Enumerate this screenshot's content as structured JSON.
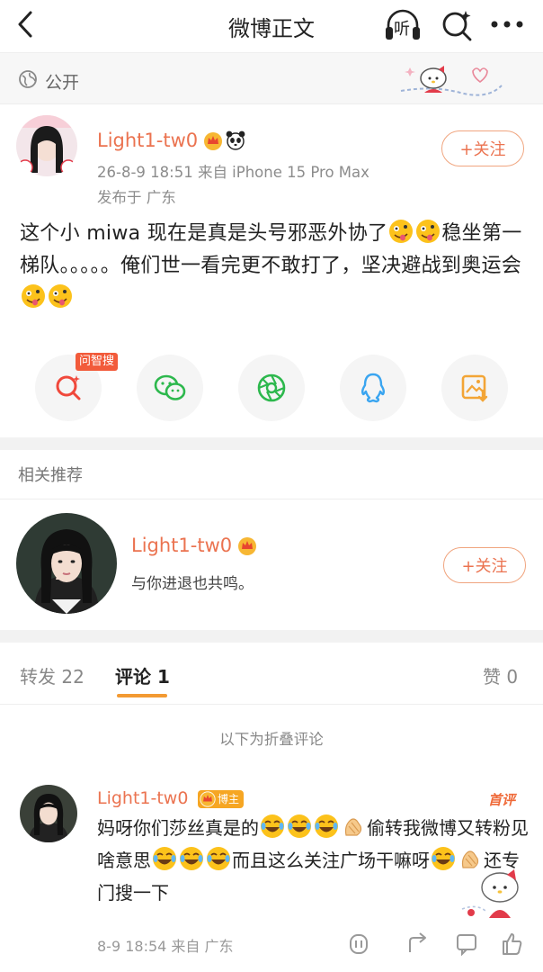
{
  "nav": {
    "title": "微博正文",
    "listen_label": "听"
  },
  "visibility": {
    "label": "公开"
  },
  "post": {
    "author": "Light1-tw0",
    "time_source": "26-8-9 18:51  来自 iPhone 15 Pro Max",
    "location": "发布于 广东",
    "follow_label": "+关注",
    "text_part1": "这个小 miwa 现在是真是头号邪恶外协了",
    "text_part2": "稳坐第一梯队。。。。。俺们世一看完更不敢打了，坚决避战到奥运会"
  },
  "share": {
    "ai_tag": "问智搜",
    "items": [
      "ai-search",
      "wechat",
      "moments",
      "qq",
      "save-image"
    ]
  },
  "recommend": {
    "section_title": "相关推荐",
    "name": "Light1-tw0",
    "desc": "与你进退也共鸣。",
    "follow_label": "+关注"
  },
  "tabs": {
    "repost": "转发 22",
    "comment": "评论 1",
    "like": "赞 0"
  },
  "folded_label": "以下为折叠评论",
  "comment": {
    "author": "Light1-tw0",
    "blogger_badge": "博主",
    "first_badge": "首评",
    "text_a": "妈呀你们莎丝真是的",
    "text_b": "偷转我微博又转粉见啥意思",
    "text_c": "而且这么关注广场干嘛呀",
    "text_d": "还专门搜一下",
    "meta": "8-9 18:54  来自 广东"
  },
  "colors": {
    "accent": "#eb7350",
    "tab_indicator": "#f39a32",
    "ai_tag": "#f25b3b"
  }
}
